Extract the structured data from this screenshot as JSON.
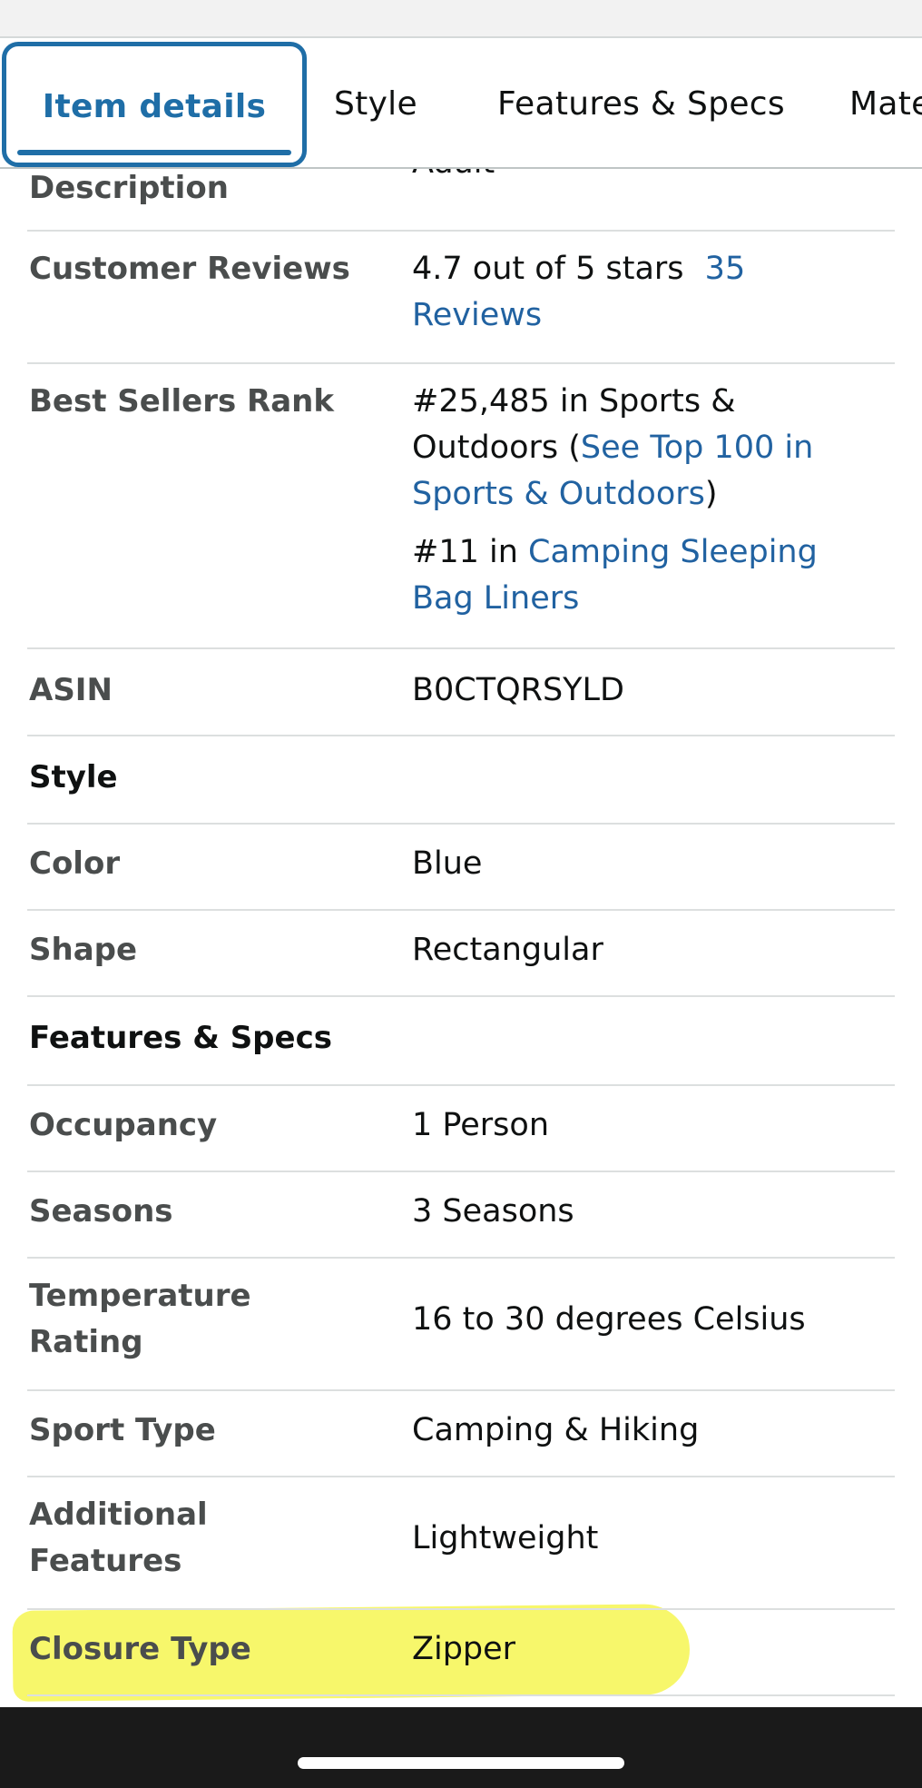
{
  "tabs": {
    "item_details": "Item details",
    "style": "Style",
    "features_specs": "Features & Specs",
    "materials_partial": "Mate"
  },
  "details": {
    "partial_value": "Adult",
    "description_label": "Description",
    "reviews_label": "Customer Reviews",
    "reviews_value": "4.7 out of 5 stars",
    "reviews_link_line1": "35",
    "reviews_link_line2": "Reviews",
    "rank_label": "Best Sellers Rank",
    "rank_value_1": "#25,485 in Sports &",
    "rank_value_2": "Outdoors (",
    "rank_link_1a": "See Top 100 in",
    "rank_link_1b": "Sports & Outdoors",
    "rank_close": ")",
    "rank_value_3": "#11 in ",
    "rank_link_2a": "Camping Sleeping",
    "rank_link_2b": "Bag Liners",
    "asin_label": "ASIN",
    "asin_value": "B0CTQRSYLD"
  },
  "style_section": {
    "heading": "Style",
    "color_label": "Color",
    "color_value": "Blue",
    "shape_label": "Shape",
    "shape_value": "Rectangular"
  },
  "features_section": {
    "heading": "Features & Specs",
    "occupancy_label": "Occupancy",
    "occupancy_value": "1 Person",
    "seasons_label": "Seasons",
    "seasons_value": "3 Seasons",
    "temp_label_1": "Temperature",
    "temp_label_2": "Rating",
    "temp_value": "16 to 30 degrees Celsius",
    "sport_label": "Sport Type",
    "sport_value": "Camping & Hiking",
    "additional_label_1": "Additional",
    "additional_label_2": "Features",
    "additional_value": "Lightweight",
    "closure_label": "Closure Type",
    "closure_value": "Zipper"
  },
  "colors": {
    "accent": "#1f6ea7",
    "link": "#2162a1",
    "highlight": "#f7f76b"
  }
}
